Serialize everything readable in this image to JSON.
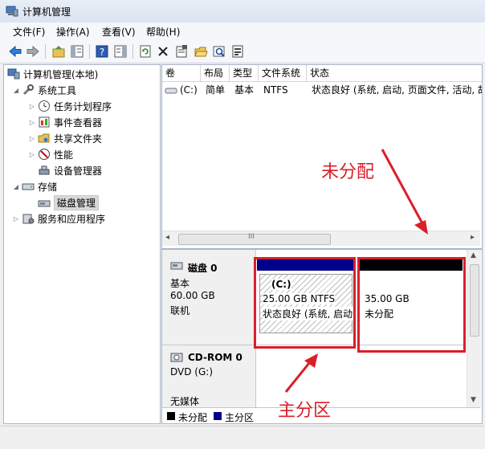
{
  "window": {
    "title": "计算机管理"
  },
  "menu": [
    {
      "label": "文件(F)"
    },
    {
      "label": "操作(A)"
    },
    {
      "label": "查看(V)"
    },
    {
      "label": "帮助(H)"
    }
  ],
  "toolbar": {
    "buttons": [
      "back-icon",
      "forward-icon",
      "up-folder-icon",
      "show-tree-icon",
      "help-icon",
      "action-pane-icon",
      "refresh-icon",
      "delete-icon",
      "properties-icon",
      "open-icon",
      "search-icon",
      "export-icon"
    ]
  },
  "tree": {
    "root": "计算机管理(本地)",
    "system_tools": "系统工具",
    "task_scheduler": "任务计划程序",
    "event_viewer": "事件查看器",
    "shared_folders": "共享文件夹",
    "performance": "性能",
    "device_manager": "设备管理器",
    "storage": "存储",
    "disk_management": "磁盘管理",
    "services_apps": "服务和应用程序"
  },
  "volume_list": {
    "headers": {
      "volume": "卷",
      "layout": "布局",
      "type": "类型",
      "fs": "文件系统",
      "status": "状态"
    },
    "rows": [
      {
        "volume": "(C:)",
        "layout": "简单",
        "type": "基本",
        "fs": "NTFS",
        "status": "状态良好 (系统, 启动, 页面文件, 活动, 故"
      }
    ],
    "scroll_left": "◂",
    "scroll_right": "▸",
    "scroll_grip": "III"
  },
  "disks": {
    "disk0": {
      "name": "磁盘 0",
      "type": "基本",
      "size": "60.00 GB",
      "state": "联机"
    },
    "primary_partition": {
      "name": "(C:)",
      "size_fs": "25.00 GB NTFS",
      "status": "状态良好 (系统, 启动"
    },
    "unallocated": {
      "size": "35.00 GB",
      "label": "未分配"
    },
    "cdrom": {
      "name": "CD-ROM 0",
      "drive": "DVD (G:)",
      "media": "无媒体"
    }
  },
  "legend": {
    "unallocated": "未分配",
    "primary": "主分区"
  },
  "annotations": {
    "unallocated": "未分配",
    "primary": "主分区"
  },
  "colors": {
    "primary_bar": "#00008b",
    "unallocated_bar": "#000000",
    "annotation_red": "#d8202a"
  }
}
